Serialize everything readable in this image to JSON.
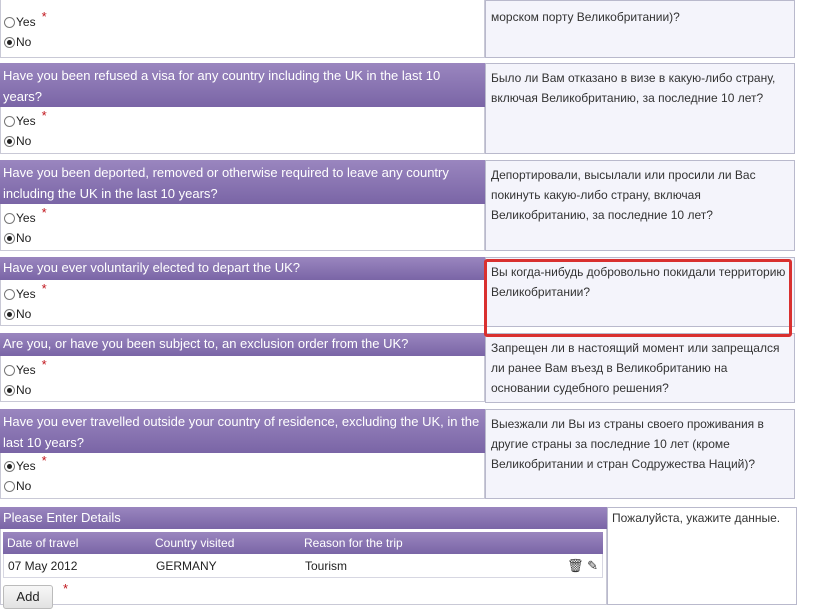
{
  "questions": [
    {
      "en": "",
      "ru": "морском порту Великобритании)?",
      "yes": "Yes",
      "no": "No",
      "selected": "No"
    },
    {
      "en": "Have you been refused a visa for any country including the UK in the last 10 years?",
      "ru": "Было ли Вам отказано в визе в какую-либо страну, включая Великобританию, за последние 10 лет?",
      "yes": "Yes",
      "no": "No",
      "selected": "No"
    },
    {
      "en": "Have you been deported, removed or otherwise required to leave any country including the UK in the last 10 years?",
      "ru": "Депортировали, высылали или просили ли Вас покинуть какую-либо страну, включая Великобританию, за последние 10 лет?",
      "yes": "Yes",
      "no": "No",
      "selected": "No"
    },
    {
      "en": "Have you ever voluntarily elected to depart the UK?",
      "ru": "Вы когда-нибудь добровольно покидали территорию Великобритании?",
      "yes": "Yes",
      "no": "No",
      "selected": "No"
    },
    {
      "en": "Are you, or have you been subject to, an exclusion order from the UK?",
      "ru": "Запрещен ли в настоящий момент или запрещался ли ранее Вам въезд в Великобританию на основании судебного решения?",
      "yes": "Yes",
      "no": "No",
      "selected": "No"
    },
    {
      "en": "Have you ever travelled outside your country of residence, excluding the UK, in the last 10 years?",
      "ru": "Выезжали ли Вы из страны своего проживания в другие страны за последние 10 лет (кроме Великобритании и стран Содружества Наций)?",
      "yes": "Yes",
      "no": "No",
      "selected": "Yes"
    }
  ],
  "required_mark": "*",
  "details": {
    "title": "Please Enter Details",
    "hint_ru": "Пожалуйста, укажите данные.",
    "columns": [
      "Date of travel",
      "Country visited",
      "Reason for the trip"
    ],
    "rows": [
      {
        "date": "07 May 2012",
        "country": "GERMANY",
        "reason": "Tourism"
      }
    ],
    "add_label": "Add"
  },
  "icons": {
    "delete": "trash-icon",
    "edit": "pencil-icon"
  },
  "colors": {
    "header": "#8a75b3",
    "required": "#c0141b",
    "highlight": "#d9302f"
  }
}
